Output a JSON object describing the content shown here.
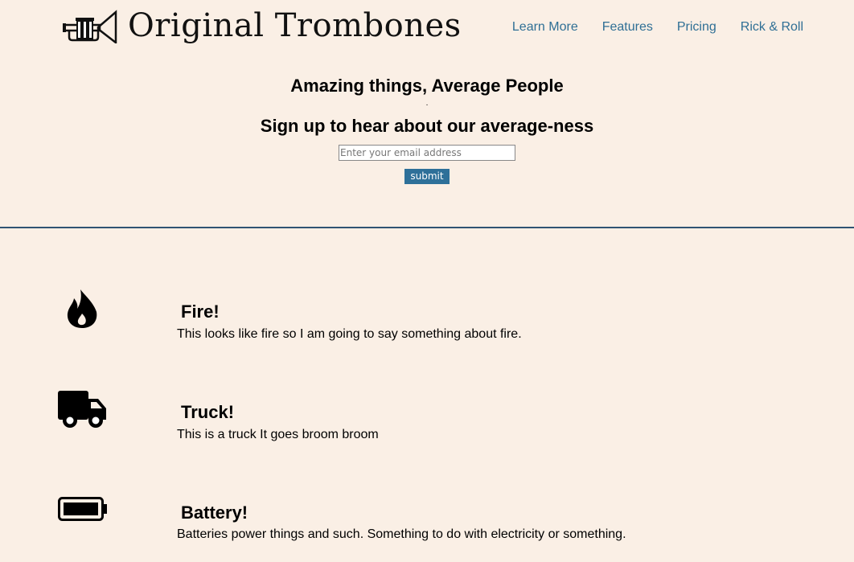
{
  "header": {
    "brand": "Original Trombones",
    "logo_icon": "trumpet-icon",
    "nav": [
      {
        "label": "Learn More"
      },
      {
        "label": "Features"
      },
      {
        "label": "Pricing"
      },
      {
        "label": "Rick & Roll"
      }
    ]
  },
  "hero": {
    "headline": "Amazing things, Average People",
    "separator": ".",
    "subheadline": "Sign up to hear about our average-ness",
    "email_placeholder": "Enter your email address",
    "submit_label": "submit"
  },
  "colors": {
    "background": "#faefe5",
    "link": "#2f6f95",
    "button": "#2e7099",
    "divider": "#2f5373"
  },
  "features": [
    {
      "icon": "fire-icon",
      "title": "Fire!",
      "text": "This looks like fire so I am going to say something about fire."
    },
    {
      "icon": "truck-icon",
      "title": "Truck!",
      "text": "This is a truck It goes broom broom"
    },
    {
      "icon": "battery-icon",
      "title": "Battery!",
      "text": "Batteries power things and such. Something to do with electricity or something."
    }
  ]
}
